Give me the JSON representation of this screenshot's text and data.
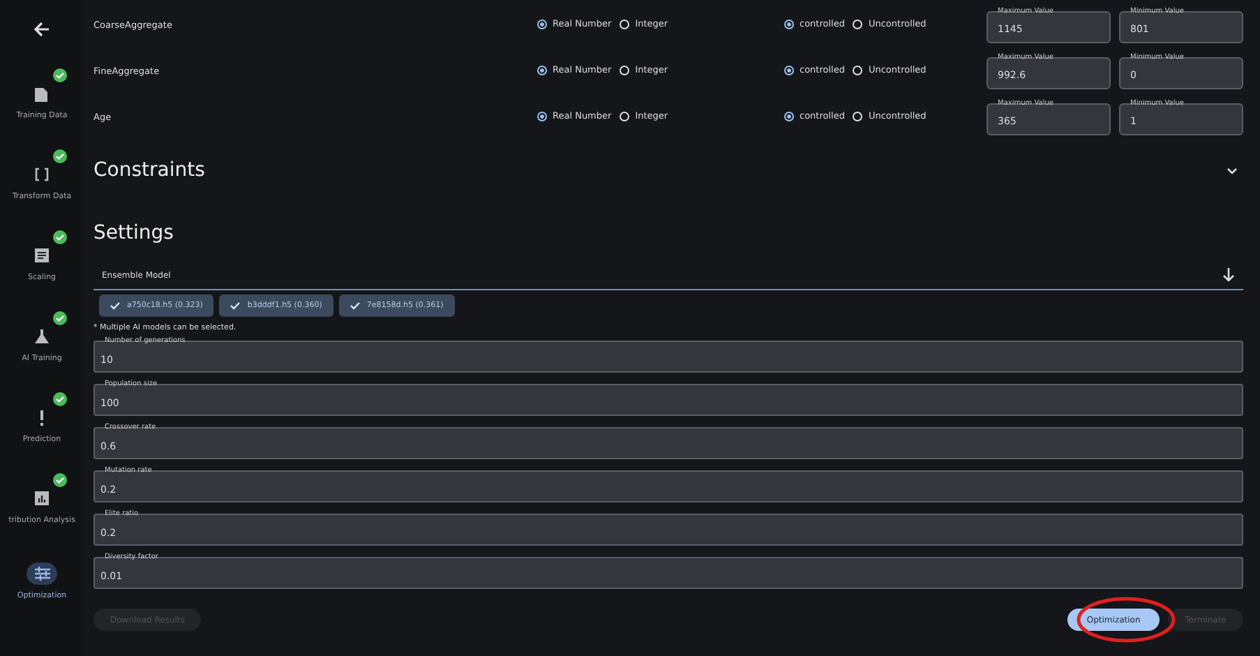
{
  "sidebar": {
    "items": [
      {
        "label": "Training Data",
        "done": true,
        "selected": false
      },
      {
        "label": "Transform Data",
        "done": true,
        "selected": false
      },
      {
        "label": "Scaling",
        "done": true,
        "selected": false
      },
      {
        "label": "AI Training",
        "done": true,
        "selected": false
      },
      {
        "label": "Prediction",
        "done": true,
        "selected": false
      },
      {
        "label": "tribution Analysis",
        "done": true,
        "selected": false
      },
      {
        "label": "Optimization",
        "done": false,
        "selected": true
      }
    ]
  },
  "variables": [
    {
      "name": "CoarseAggregate",
      "types": [
        {
          "label": "Real Number",
          "selected": true
        },
        {
          "label": "Integer",
          "selected": false
        }
      ],
      "control": [
        {
          "label": "controlled",
          "selected": true
        },
        {
          "label": "Uncontrolled",
          "selected": false
        }
      ],
      "max_label": "Maximum Value",
      "max": "1145",
      "min_label": "Minimum Value",
      "min": "801"
    },
    {
      "name": "FineAggregate",
      "types": [
        {
          "label": "Real Number",
          "selected": true
        },
        {
          "label": "Integer",
          "selected": false
        }
      ],
      "control": [
        {
          "label": "controlled",
          "selected": true
        },
        {
          "label": "Uncontrolled",
          "selected": false
        }
      ],
      "max_label": "Maximum Value",
      "max": "992.6",
      "min_label": "Minimum Value",
      "min": "0"
    },
    {
      "name": "Age",
      "types": [
        {
          "label": "Real Number",
          "selected": true
        },
        {
          "label": "Integer",
          "selected": false
        }
      ],
      "control": [
        {
          "label": "controlled",
          "selected": true
        },
        {
          "label": "Uncontrolled",
          "selected": false
        }
      ],
      "max_label": "Maximum Value",
      "max": "365",
      "min_label": "Minimum Value",
      "min": "1"
    }
  ],
  "constraints": {
    "title": "Constraints",
    "expanded": false
  },
  "settings": {
    "title": "Settings",
    "ensemble_label": "Ensemble Model",
    "models": [
      "a750c18.h5 (0.323)",
      "b3dddf1.h5 (0.360)",
      "7e8158d.h5 (0.361)"
    ],
    "note": "* Multiple AI models can be selected.",
    "fields": [
      {
        "label": "Number of generations",
        "value": "10"
      },
      {
        "label": "Population size",
        "value": "100"
      },
      {
        "label": "Crossover rate",
        "value": "0.6"
      },
      {
        "label": "Mutation rate",
        "value": "0.2"
      },
      {
        "label": "Elite ratio",
        "value": "0.2"
      },
      {
        "label": "Diversity factor",
        "value": "0.01"
      }
    ]
  },
  "buttons": [
    {
      "label": "Download Results",
      "disabled": true,
      "kind": "left"
    },
    {
      "label": "Optimization",
      "disabled": false,
      "kind": "right"
    },
    {
      "label": "Terminate",
      "disabled": true,
      "kind": "right"
    }
  ]
}
